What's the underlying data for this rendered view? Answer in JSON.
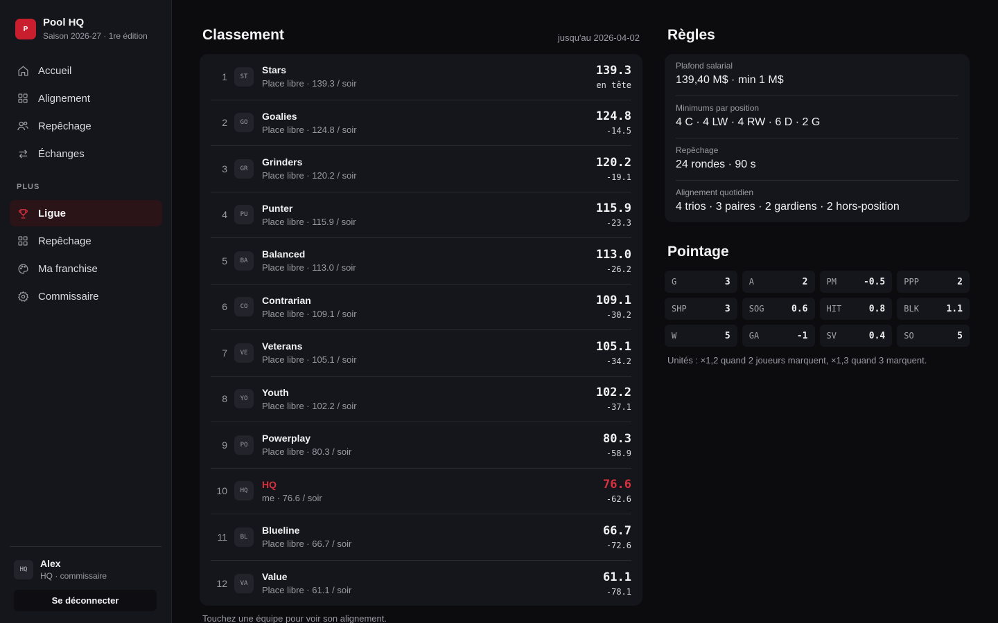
{
  "brand": {
    "logo_letter": "P",
    "title": "Pool HQ",
    "subtitle": "Saison 2026-27 · 1re édition"
  },
  "nav_main": [
    {
      "label": "Accueil",
      "icon": "home-icon"
    },
    {
      "label": "Alignement",
      "icon": "grid-icon"
    },
    {
      "label": "Repêchage",
      "icon": "users-icon"
    },
    {
      "label": "Échanges",
      "icon": "swap-icon"
    }
  ],
  "nav_section_label": "PLUS",
  "nav_more": [
    {
      "label": "Ligue",
      "icon": "trophy-icon",
      "active": true
    },
    {
      "label": "Repêchage",
      "icon": "grid-icon"
    },
    {
      "label": "Ma franchise",
      "icon": "palette-icon"
    },
    {
      "label": "Commissaire",
      "icon": "gear-icon"
    }
  ],
  "user": {
    "avatar": "HQ",
    "name": "Alex",
    "role": "HQ · commissaire"
  },
  "logout_label": "Se déconnecter",
  "standings": {
    "title": "Classement",
    "date_note": "jusqu'au 2026-04-02",
    "rows": [
      {
        "rank": "1",
        "badge": "ST",
        "name": "Stars",
        "sub": "Place libre · 139.3 / soir",
        "pts": "139.3",
        "diff": "en tête"
      },
      {
        "rank": "2",
        "badge": "GO",
        "name": "Goalies",
        "sub": "Place libre · 124.8 / soir",
        "pts": "124.8",
        "diff": "-14.5"
      },
      {
        "rank": "3",
        "badge": "GR",
        "name": "Grinders",
        "sub": "Place libre · 120.2 / soir",
        "pts": "120.2",
        "diff": "-19.1"
      },
      {
        "rank": "4",
        "badge": "PU",
        "name": "Punter",
        "sub": "Place libre · 115.9 / soir",
        "pts": "115.9",
        "diff": "-23.3"
      },
      {
        "rank": "5",
        "badge": "BA",
        "name": "Balanced",
        "sub": "Place libre · 113.0 / soir",
        "pts": "113.0",
        "diff": "-26.2"
      },
      {
        "rank": "6",
        "badge": "CO",
        "name": "Contrarian",
        "sub": "Place libre · 109.1 / soir",
        "pts": "109.1",
        "diff": "-30.2"
      },
      {
        "rank": "7",
        "badge": "VE",
        "name": "Veterans",
        "sub": "Place libre · 105.1 / soir",
        "pts": "105.1",
        "diff": "-34.2"
      },
      {
        "rank": "8",
        "badge": "YO",
        "name": "Youth",
        "sub": "Place libre · 102.2 / soir",
        "pts": "102.2",
        "diff": "-37.1"
      },
      {
        "rank": "9",
        "badge": "PO",
        "name": "Powerplay",
        "sub": "Place libre · 80.3 / soir",
        "pts": "80.3",
        "diff": "-58.9"
      },
      {
        "rank": "10",
        "badge": "HQ",
        "name": "HQ",
        "sub": "me · 76.6 / soir",
        "pts": "76.6",
        "diff": "-62.6",
        "me": true
      },
      {
        "rank": "11",
        "badge": "BL",
        "name": "Blueline",
        "sub": "Place libre · 66.7 / soir",
        "pts": "66.7",
        "diff": "-72.6"
      },
      {
        "rank": "12",
        "badge": "VA",
        "name": "Value",
        "sub": "Place libre · 61.1 / soir",
        "pts": "61.1",
        "diff": "-78.1"
      }
    ],
    "footnote": "Touchez une équipe pour voir son alignement."
  },
  "rules": {
    "title": "Règles",
    "items": [
      {
        "label": "Plafond salarial",
        "value": "139,40 M$ · min 1 M$"
      },
      {
        "label": "Minimums par position",
        "value": "4 C · 4 LW · 4 RW · 6 D · 2 G"
      },
      {
        "label": "Repêchage",
        "value": "24 rondes · 90 s"
      },
      {
        "label": "Alignement quotidien",
        "value": "4 trios · 3 paires · 2 gardiens · 2 hors-position"
      }
    ]
  },
  "scoring": {
    "title": "Pointage",
    "tiles": [
      {
        "k": "G",
        "v": "3"
      },
      {
        "k": "A",
        "v": "2"
      },
      {
        "k": "PM",
        "v": "-0.5"
      },
      {
        "k": "PPP",
        "v": "2"
      },
      {
        "k": "SHP",
        "v": "3"
      },
      {
        "k": "SOG",
        "v": "0.6"
      },
      {
        "k": "HIT",
        "v": "0.8"
      },
      {
        "k": "BLK",
        "v": "1.1"
      },
      {
        "k": "W",
        "v": "5"
      },
      {
        "k": "GA",
        "v": "-1"
      },
      {
        "k": "SV",
        "v": "0.4"
      },
      {
        "k": "SO",
        "v": "5"
      }
    ],
    "units_note": "Unités : ×1,2 quand 2 joueurs marquent, ×1,3 quand 3 marquent."
  },
  "colors": {
    "accent": "#c81e2d",
    "me_text": "#d8313f",
    "panel": "#15161b",
    "background": "#0c0c0f"
  }
}
